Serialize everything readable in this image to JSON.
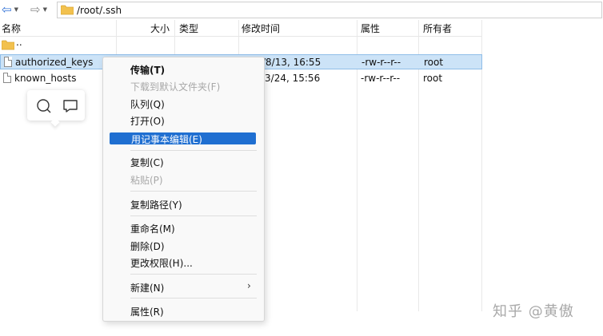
{
  "toolbar": {
    "back_icon": "arrow-left-icon",
    "forward_icon": "arrow-right-icon",
    "path": "/root/.ssh"
  },
  "columns": {
    "name": "名称",
    "size": "大小",
    "type": "类型",
    "modified": "修改时间",
    "attributes": "属性",
    "owner": "所有者"
  },
  "rows": [
    {
      "name": "..",
      "modified": "",
      "attributes": "",
      "owner": ""
    },
    {
      "name": "authorized_keys",
      "modified": "/8/13, 16:55",
      "attributes": "-rw-r--r--",
      "owner": "root"
    },
    {
      "name": "known_hosts",
      "modified": "/3/24, 15:56",
      "attributes": "-rw-r--r--",
      "owner": "root"
    }
  ],
  "context_menu": {
    "items": [
      {
        "label": "传输(T)",
        "bold": true
      },
      {
        "label": "下载到默认文件夹(F)",
        "disabled": true
      },
      {
        "label": "队列(Q)"
      },
      {
        "label": "打开(O)"
      },
      {
        "label": "用记事本编辑(E)",
        "highlighted": true
      },
      {
        "label": "复制(C)"
      },
      {
        "label": "粘贴(P)",
        "disabled": true
      },
      {
        "label": "复制路径(Y)"
      },
      {
        "label": "重命名(M)"
      },
      {
        "label": "删除(D)"
      },
      {
        "label": "更改权限(H)..."
      },
      {
        "label": "新建(N)"
      },
      {
        "label": "属性(R)"
      }
    ],
    "submenu_arrow": "›"
  },
  "watermark": "知乎 @黄傲",
  "colors": {
    "highlight": "#1f6fd1",
    "selection": "#cce3f7"
  }
}
